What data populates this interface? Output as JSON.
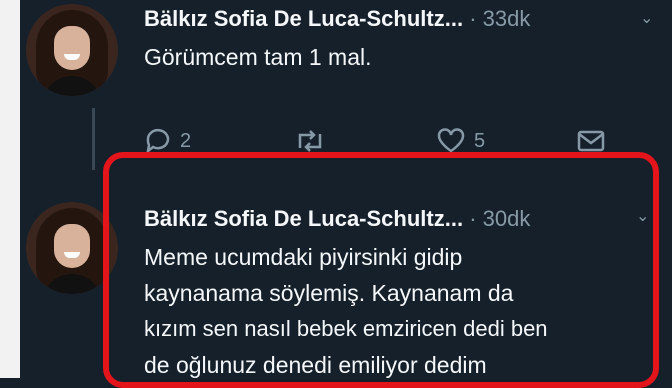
{
  "tweets": [
    {
      "author": "Bälkız Sofia De Luca-Schultz...",
      "separator": "·",
      "time": "33dk",
      "text": "Görümcem tam 1 mal.",
      "actions": {
        "reply_count": "2",
        "like_count": "5"
      }
    },
    {
      "author": "Bälkız Sofia De Luca-Schultz...",
      "separator": "·",
      "time": "30dk",
      "lines": [
        "Meme ucumdaki piyirsinki gidip",
        "kaynanama söylemiş. Kaynanam da",
        "kızım sen nasıl bebek emziricen dedi ben",
        "de oğlunuz denedi emiliyor dedim"
      ]
    }
  ],
  "colors": {
    "background": "#15202b",
    "highlight": "#e4141b",
    "muted": "#8899a6"
  },
  "icons": [
    "reply-icon",
    "retweet-icon",
    "like-icon",
    "share-icon",
    "chevron-down-icon"
  ]
}
